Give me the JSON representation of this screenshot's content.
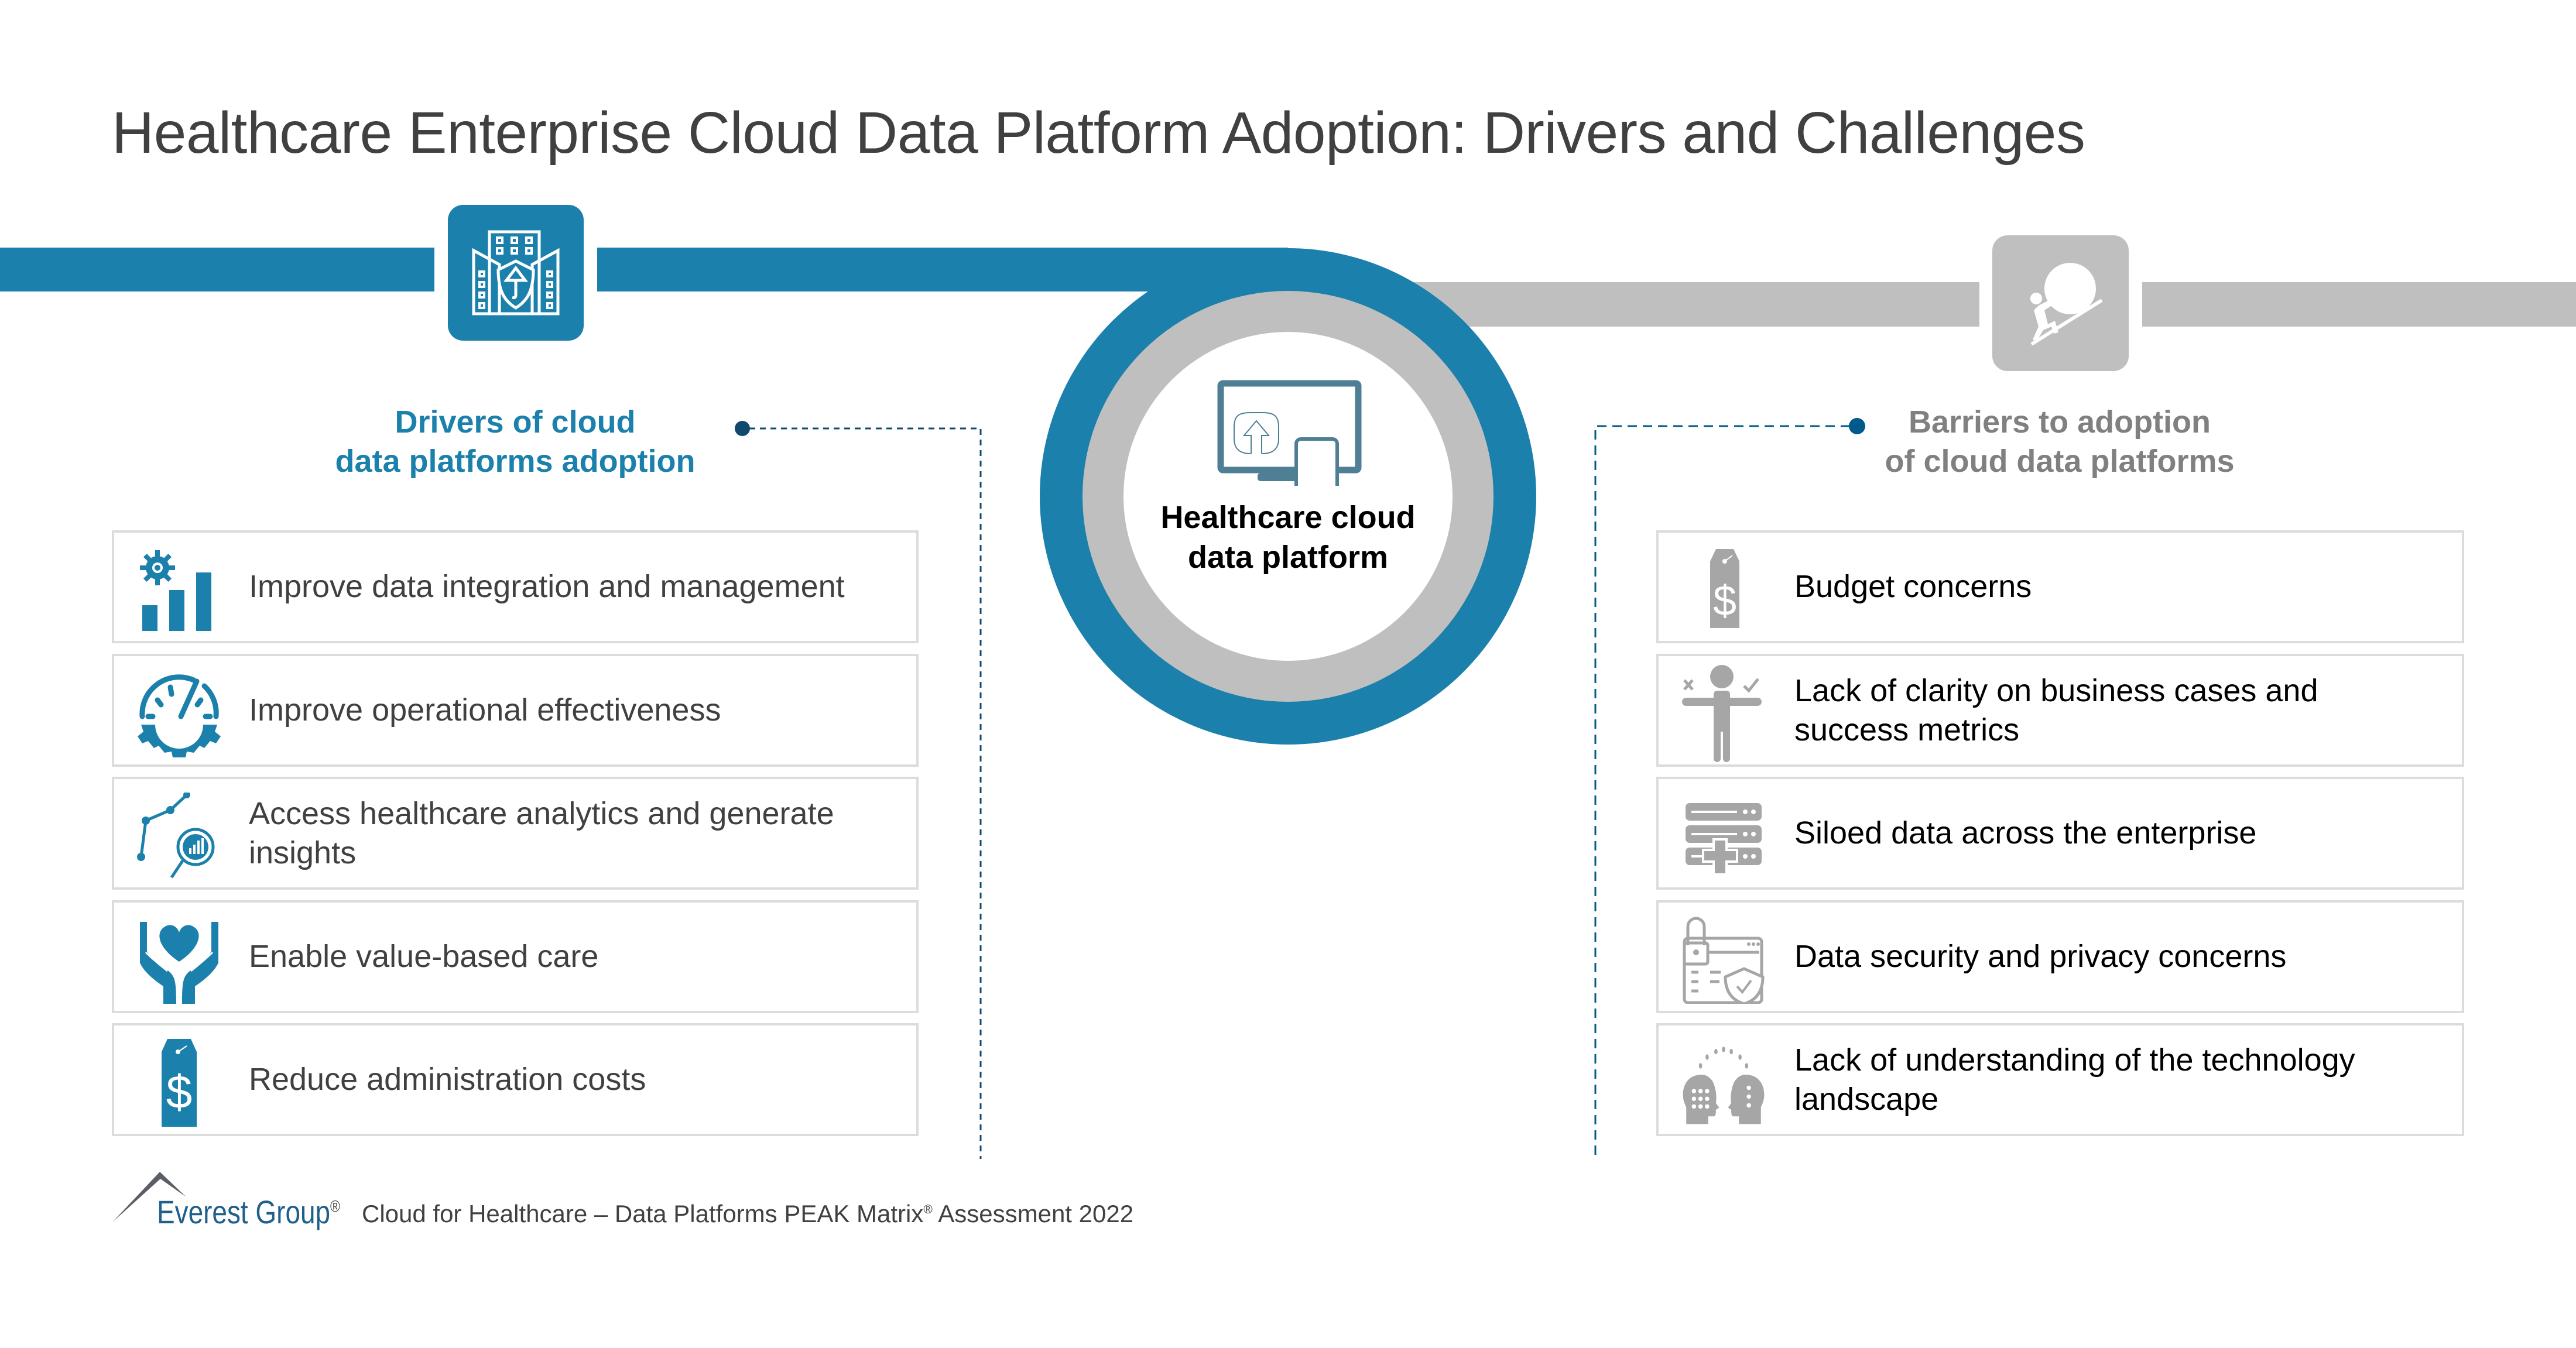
{
  "title": "Healthcare Enterprise Cloud Data Platform Adoption: Drivers and Challenges",
  "colors": {
    "accent_blue": "#1b80ab",
    "accent_gray": "#bfbfbf",
    "connector_dark": "#0f4a6e",
    "connector_blue": "#005a8c"
  },
  "center": {
    "icon": "monitor-cloud-upload-mobile-icon",
    "label_line1": "Healthcare cloud",
    "label_line2": "data platform"
  },
  "drivers": {
    "header_icon": "building-shield-umbrella-icon",
    "heading_line1": "Drivers of cloud",
    "heading_line2": "data platforms adoption",
    "items": [
      {
        "icon": "gear-bar-chart-icon",
        "label": "Improve data integration and management"
      },
      {
        "icon": "gauge-gear-icon",
        "label": "Improve operational effectiveness"
      },
      {
        "icon": "analytics-magnifier-icon",
        "label": "Access healthcare analytics and generate insights"
      },
      {
        "icon": "hands-heart-icon",
        "label": "Enable value-based care"
      },
      {
        "icon": "dollar-tag-icon",
        "label": "Reduce administration costs"
      }
    ]
  },
  "barriers": {
    "header_icon": "person-pushing-boulder-icon",
    "heading_line1": "Barriers to adoption",
    "heading_line2": "of cloud data platforms",
    "items": [
      {
        "icon": "dollar-tag-icon",
        "label": "Budget concerns"
      },
      {
        "icon": "person-decision-icon",
        "label": "Lack of clarity on business cases and success metrics"
      },
      {
        "icon": "server-stack-icon",
        "label": "Siloed data across the enterprise"
      },
      {
        "icon": "lock-shield-icon",
        "label": "Data security and privacy concerns"
      },
      {
        "icon": "two-heads-thinking-icon",
        "label": "Lack of understanding of the technology landscape"
      }
    ]
  },
  "footer": {
    "brand": "Everest Group",
    "brand_mark": "®",
    "text_before": "Cloud for Healthcare – Data Platforms PEAK Matrix",
    "text_mark": "®",
    "text_after": " Assessment 2022"
  }
}
